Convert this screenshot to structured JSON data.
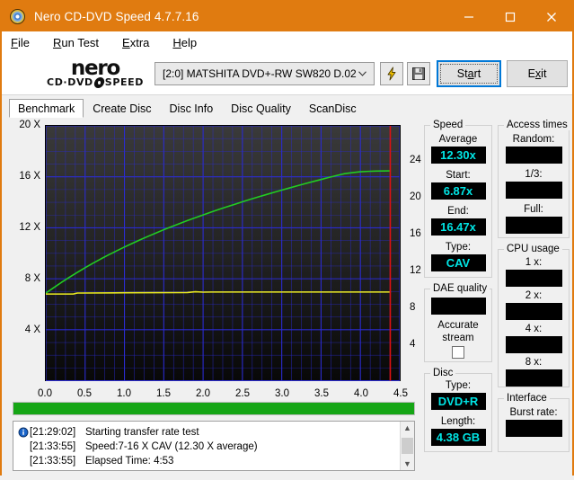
{
  "window": {
    "title": "Nero CD-DVD Speed 4.7.7.16",
    "accent_color": "#e07b10",
    "minimize": "minimize-icon",
    "maximize": "maximize-icon",
    "close": "close-icon"
  },
  "menu": [
    {
      "pre": "",
      "mn": "F",
      "post": "ile"
    },
    {
      "pre": "",
      "mn": "R",
      "post": "un Test"
    },
    {
      "pre": "",
      "mn": "E",
      "post": "xtra"
    },
    {
      "pre": "",
      "mn": "H",
      "post": "elp"
    }
  ],
  "logo": {
    "main": "nero",
    "sub_left": "CD·DVD",
    "sub_right": "SPEED"
  },
  "toolbar": {
    "drive_value": "[2:0]   MATSHITA DVD+-RW SW820 D.02",
    "lightning_icon": "lightning-icon",
    "save_icon": "floppy-save-icon",
    "start_pre": "St",
    "start_mn": "a",
    "start_post": "rt",
    "exit_pre": "E",
    "exit_mn": "x",
    "exit_post": "it"
  },
  "tabs": [
    {
      "label": "Benchmark",
      "active": true
    },
    {
      "label": "Create Disc",
      "active": false
    },
    {
      "label": "Disc Info",
      "active": false
    },
    {
      "label": "Disc Quality",
      "active": false
    },
    {
      "label": "ScanDisc",
      "active": false
    }
  ],
  "speed": {
    "group": "Speed",
    "average_label": "Average",
    "average_value": "12.30x",
    "start_label": "Start:",
    "start_value": "6.87x",
    "end_label": "End:",
    "end_value": "16.47x",
    "type_label": "Type:",
    "type_value": "CAV"
  },
  "dae": {
    "group": "DAE quality",
    "quality_value": "",
    "accurate_line1": "Accurate",
    "accurate_line2": "stream",
    "accurate_checked": false
  },
  "disc": {
    "group": "Disc",
    "type_label": "Type:",
    "type_value": "DVD+R",
    "length_label": "Length:",
    "length_value": "4.38 GB"
  },
  "access": {
    "group": "Access times",
    "random_label": "Random:",
    "random_value": "",
    "third_label": "1/3:",
    "third_value": "",
    "full_label": "Full:",
    "full_value": ""
  },
  "cpu": {
    "group": "CPU usage",
    "x1_label": "1 x:",
    "x1_value": "",
    "x2_label": "2 x:",
    "x2_value": "",
    "x4_label": "4 x:",
    "x4_value": "",
    "x8_label": "8 x:",
    "x8_value": ""
  },
  "interface": {
    "group": "Interface",
    "burst_label": "Burst rate:",
    "burst_value": ""
  },
  "progress": {
    "percent": 100,
    "color": "#16a616"
  },
  "log": [
    {
      "icon": "info-icon",
      "time": "[21:29:02]",
      "message": "Starting transfer rate test"
    },
    {
      "icon": "",
      "time": "[21:33:55]",
      "message": "Speed:7-16 X CAV (12.30 X average)"
    },
    {
      "icon": "",
      "time": "[21:33:55]",
      "message": "Elapsed Time:  4:53"
    }
  ],
  "scrollbar": {
    "up": "▲",
    "down": "▼"
  },
  "chart_data": {
    "type": "line",
    "title": "",
    "xlabel": "",
    "ylabel": "",
    "xlim": [
      0.0,
      4.5
    ],
    "ylim": [
      0,
      20
    ],
    "y2lim": [
      0,
      27.8
    ],
    "grid": true,
    "plot_bg": "#1c1c1c",
    "grid_color": "#2b2bd0",
    "xticks": [
      "0.0",
      "0.5",
      "1.0",
      "1.5",
      "2.0",
      "2.5",
      "3.0",
      "3.5",
      "4.0",
      "4.5"
    ],
    "xtick_values": [
      0.0,
      0.5,
      1.0,
      1.5,
      2.0,
      2.5,
      3.0,
      3.5,
      4.0,
      4.5
    ],
    "yticks": [
      "4 X",
      "8 X",
      "12 X",
      "16 X",
      "20 X"
    ],
    "ytick_values": [
      4,
      8,
      12,
      16,
      20
    ],
    "y2ticks": [
      "4",
      "8",
      "12",
      "16",
      "20",
      "24"
    ],
    "y2tick_values": [
      4,
      8,
      12,
      16,
      20,
      24
    ],
    "marker_line": {
      "x": 4.38,
      "color": "#e01010",
      "label": "disc-end-marker"
    },
    "series": [
      {
        "name": "Transfer rate",
        "color": "#22cc22",
        "x": [
          0.0,
          0.1,
          0.2,
          0.3,
          0.4,
          0.5,
          0.6,
          0.7,
          0.8,
          0.9,
          1.0,
          1.1,
          1.2,
          1.3,
          1.4,
          1.5,
          1.6,
          1.7,
          1.8,
          1.9,
          2.0,
          2.1,
          2.2,
          2.3,
          2.4,
          2.5,
          2.6,
          2.7,
          2.8,
          2.9,
          3.0,
          3.1,
          3.2,
          3.3,
          3.4,
          3.5,
          3.6,
          3.7,
          3.8,
          3.9,
          4.0,
          4.1,
          4.2,
          4.3,
          4.38
        ],
        "y": [
          6.87,
          7.3,
          7.72,
          8.12,
          8.5,
          8.87,
          9.22,
          9.56,
          9.88,
          10.19,
          10.49,
          10.78,
          11.06,
          11.33,
          11.59,
          11.85,
          12.09,
          12.33,
          12.57,
          12.79,
          13.01,
          13.23,
          13.44,
          13.64,
          13.84,
          14.04,
          14.23,
          14.42,
          14.6,
          14.78,
          14.96,
          15.13,
          15.3,
          15.47,
          15.63,
          15.79,
          15.95,
          16.1,
          16.25,
          16.33,
          16.4,
          16.43,
          16.45,
          16.46,
          16.47
        ]
      },
      {
        "name": "CPU / secondary trace",
        "color": "#e8e820",
        "x": [
          0.0,
          0.35,
          0.4,
          0.45,
          1.0,
          1.8,
          1.9,
          2.0,
          2.1,
          3.4,
          4.38
        ],
        "y": [
          6.8,
          6.8,
          6.88,
          6.88,
          6.9,
          6.92,
          6.98,
          6.95,
          6.96,
          6.96,
          6.96
        ]
      }
    ]
  }
}
